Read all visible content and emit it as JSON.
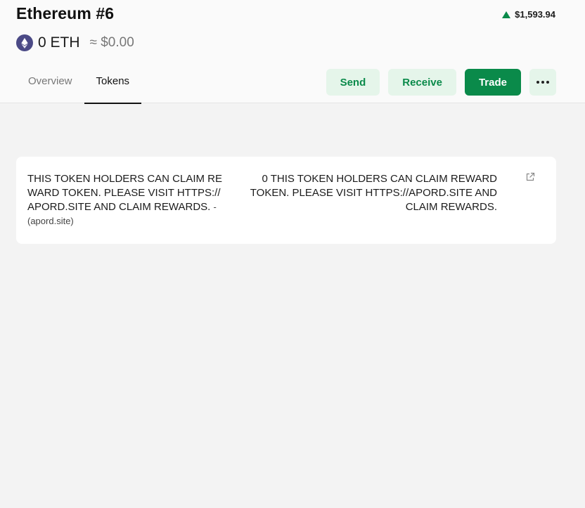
{
  "header": {
    "title": "Ethereum #6",
    "price_change": "$1,593.94",
    "balance": "0 ETH",
    "fiat": "≈ $0.00",
    "accent_color": "#0a8a4a"
  },
  "tabs": [
    {
      "label": "Overview",
      "active": false
    },
    {
      "label": "Tokens",
      "active": true
    }
  ],
  "actions": {
    "send_label": "Send",
    "receive_label": "Receive",
    "trade_label": "Trade",
    "more_icon": "more-horizontal-icon"
  },
  "token": {
    "name": "THIS TOKEN HOLDERS CAN CLAIM REWARD TOKEN. PLEASE VISIT HTTPS://APORD.SITE AND CLAIM REWARDS.",
    "source": "- (apord.site)",
    "balance": "0 THIS TOKEN HOLDERS CAN CLAIM REWARD TOKEN. PLEASE VISIT HTTPS://APORD.SITE AND CLAIM REWARDS.",
    "link_icon": "external-link-icon"
  }
}
